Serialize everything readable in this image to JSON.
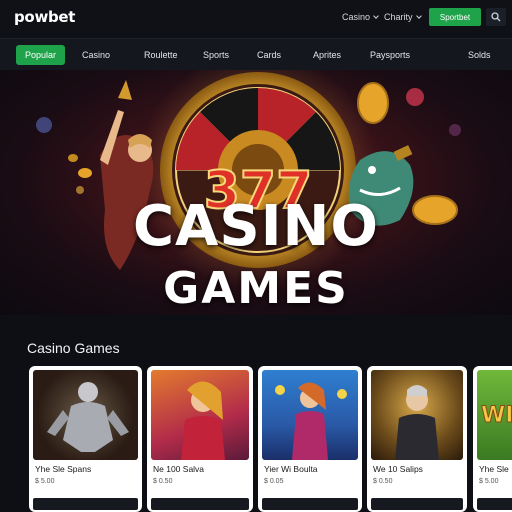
{
  "header": {
    "logo_text": "powbet",
    "links": [
      {
        "label": "Casino",
        "has_dropdown": true
      },
      {
        "label": "Charity",
        "has_dropdown": true
      }
    ],
    "signup_label": "Sportbet",
    "search_icon": "search-icon"
  },
  "nav": {
    "items": [
      {
        "label": "Popular",
        "active": true
      },
      {
        "label": "Casino",
        "active": false
      },
      {
        "label": "Roulette",
        "active": false
      },
      {
        "label": "Sports",
        "active": false
      },
      {
        "label": "Cards",
        "active": false
      },
      {
        "label": "Aprites",
        "active": false
      },
      {
        "label": "Paysports",
        "active": false
      },
      {
        "label": "Solds",
        "active": false
      }
    ]
  },
  "hero": {
    "title_line1": "CASINO",
    "title_line2": "GAMES",
    "slot_text": "377"
  },
  "section": {
    "title": "Casino Games"
  },
  "cards": [
    {
      "title": "Yhe Sle Spans",
      "meta": "$ 5.00"
    },
    {
      "title": "Ne 100 Salva",
      "meta": "$ 0.50"
    },
    {
      "title": "Yier Wi Boulta",
      "meta": "$ 0.05"
    },
    {
      "title": "We 10 Salips",
      "meta": "$ 0.50"
    },
    {
      "title": "Yhe Sle",
      "meta": "$ 5.00"
    }
  ],
  "colors": {
    "accent_green": "#1fa34a",
    "page_bg": "#0d0f14",
    "gold": "#e6a52a"
  }
}
